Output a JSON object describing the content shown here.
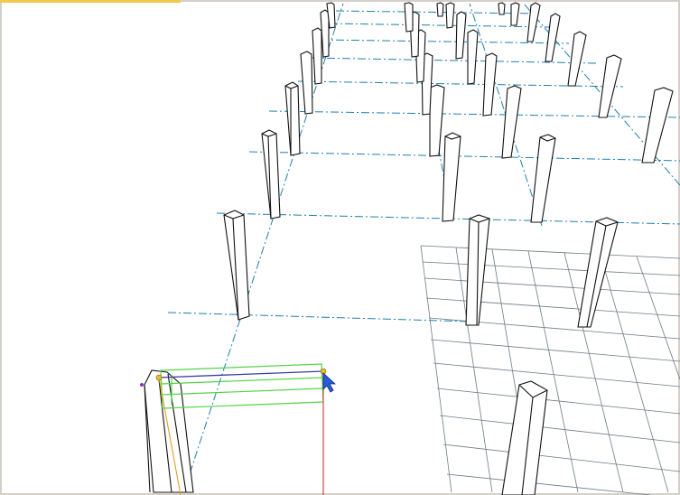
{
  "viewport": {
    "background": "#ffffff",
    "frame_color": "#d4d0c8",
    "active_indicator_color": "#f2c94c",
    "axis_line_color": "#1f7fb0",
    "grid_color": "#6e7b84",
    "column_edge_color": "#111111",
    "selection_color": "#55d24a",
    "tool_x_axis_color": "#3a3aa8",
    "tool_z_axis_color": "#d43a3a",
    "tool_y_axis_color": "#e0a020",
    "cursor": {
      "icon": "arrow-cursor-icon",
      "color": "#2b5bd8"
    },
    "snap_point_color": "#e8c020",
    "endpoint_color": "#9030c0"
  }
}
